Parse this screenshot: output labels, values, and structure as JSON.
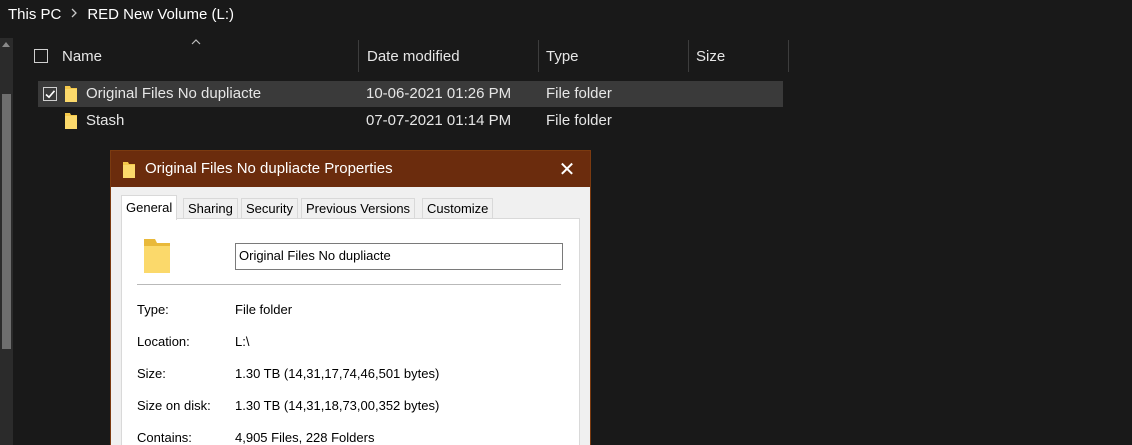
{
  "breadcrumb": {
    "items": [
      "This PC",
      "RED New Volume (L:)"
    ]
  },
  "columns": {
    "name": "Name",
    "date_modified": "Date modified",
    "type": "Type",
    "size": "Size"
  },
  "rows": [
    {
      "name": "Original Files No dupliacte",
      "date": "10-06-2021 01:26 PM",
      "type": "File folder",
      "selected": true
    },
    {
      "name": "Stash",
      "date": "07-07-2021 01:14 PM",
      "type": "File folder",
      "selected": false
    }
  ],
  "dialog": {
    "title": "Original Files No dupliacte Properties",
    "close_glyph": "✕",
    "tabs": [
      "General",
      "Sharing",
      "Security",
      "Previous Versions",
      "Customize"
    ],
    "folder_name": "Original Files No dupliacte",
    "properties": [
      {
        "label": "Type:",
        "value": "File folder"
      },
      {
        "label": "Location:",
        "value": "L:\\"
      },
      {
        "label": "Size:",
        "value": "1.30 TB (14,31,17,74,46,501 bytes)"
      },
      {
        "label": "Size on disk:",
        "value": "1.30 TB (14,31,18,73,00,352 bytes)"
      },
      {
        "label": "Contains:",
        "value": "4,905 Files, 228 Folders"
      }
    ]
  },
  "colors": {
    "background": "#191919",
    "selection": "#3a3a3a",
    "dialog_titlebar": "#6b2c0d",
    "folder": "#f4c84a"
  },
  "icons": {
    "chevron": "chevron-right-icon",
    "folder": "folder-icon",
    "sort": "sort-ascending-icon"
  }
}
